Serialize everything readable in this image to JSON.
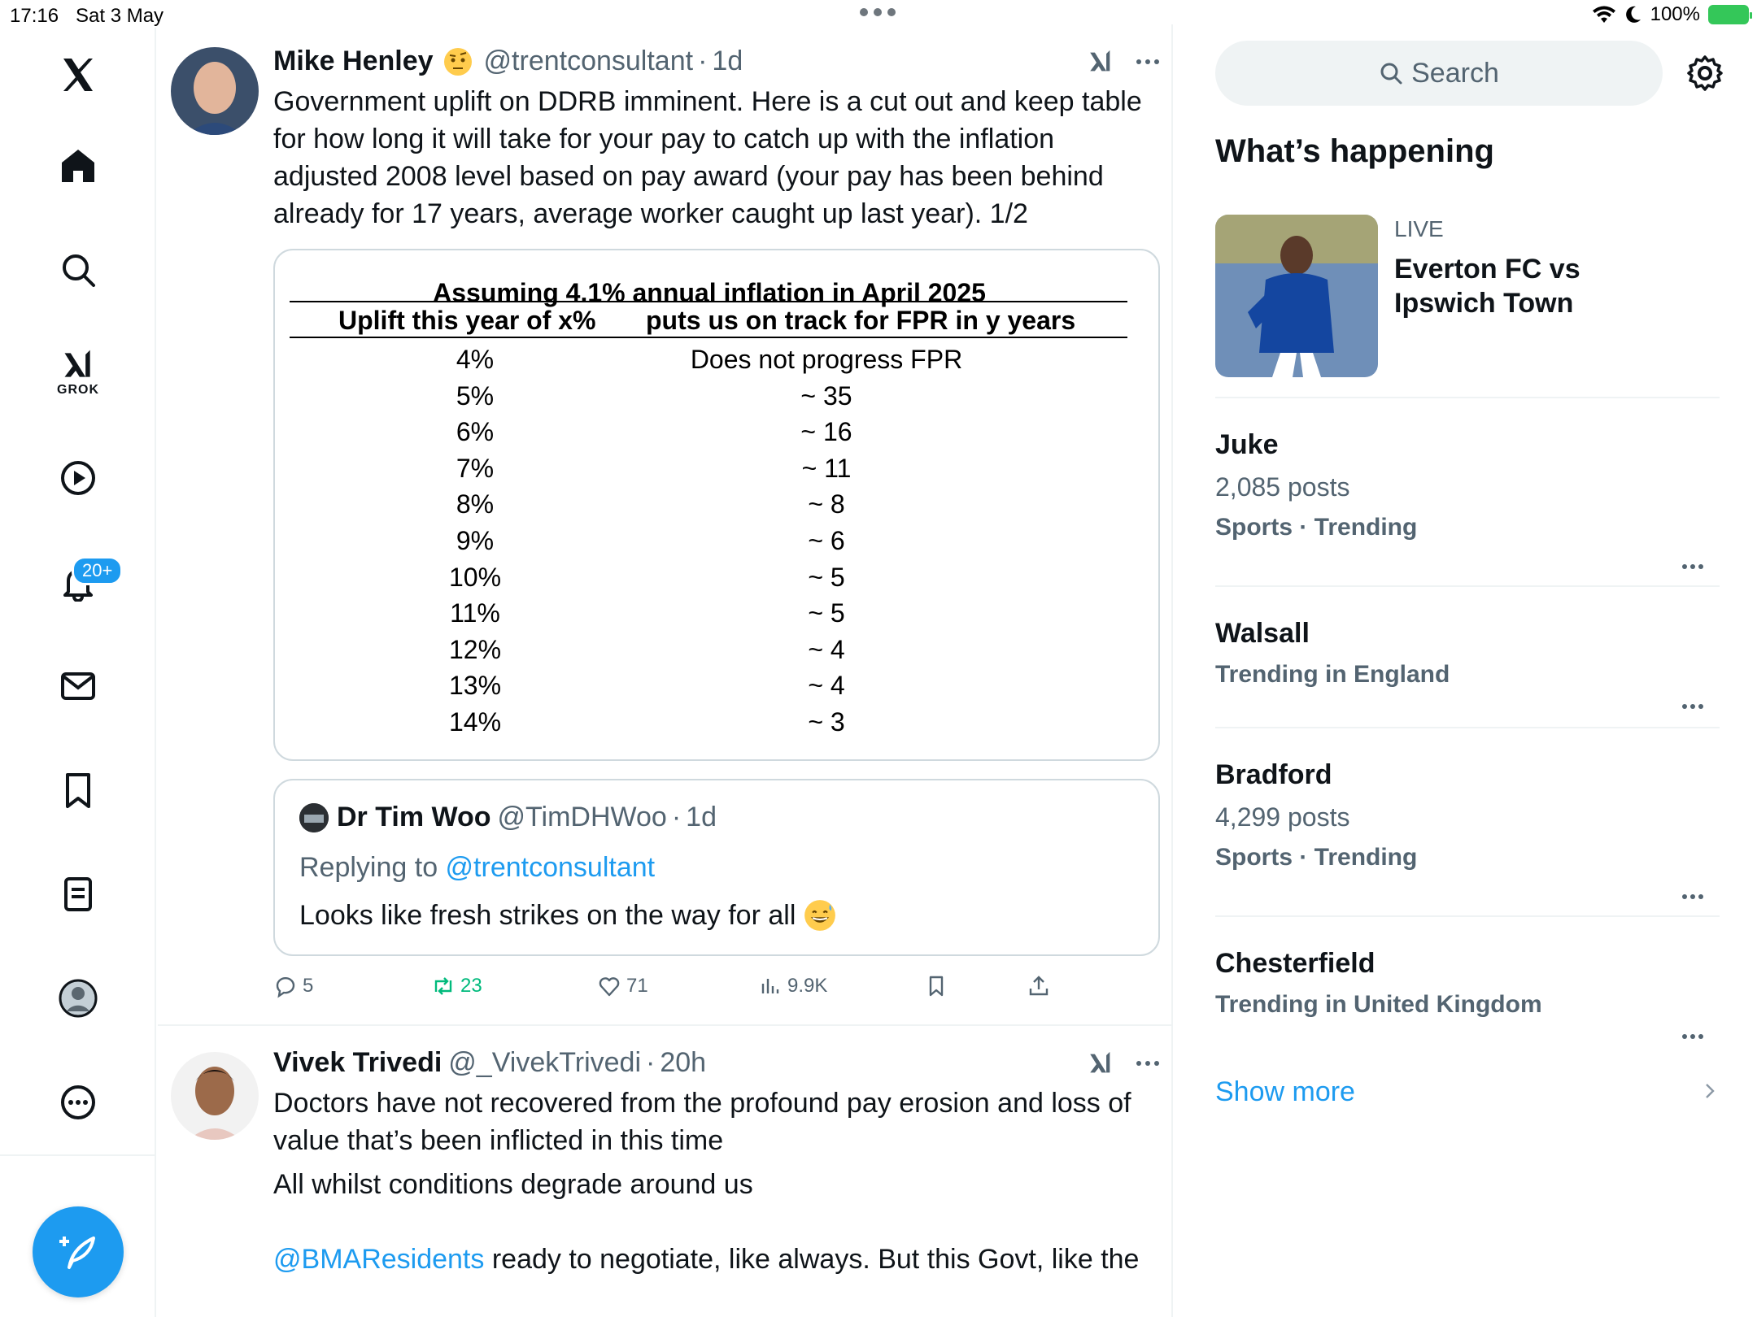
{
  "status_bar": {
    "time": "17:16",
    "date": "Sat 3 May",
    "battery": "100%"
  },
  "nav": {
    "grok_label": "GROK",
    "notifications_badge": "20+"
  },
  "posts": [
    {
      "name": "Mike Henley",
      "handle": "@trentconsultant",
      "sep": "·",
      "time": "1d",
      "text": "Government uplift on DDRB imminent. Here is a cut out and keep table for how long it will take for your pay to catch up with the inflation adjusted 2008 level based on pay award (your pay has been behind already for 17 years, average worker caught up last year). 1/2",
      "table": {
        "title": "Assuming 4.1% annual inflation in April 2025",
        "col1": "Uplift this year of x%",
        "col2": "puts us on track for FPR in y years",
        "rows": [
          [
            "4%",
            "Does not progress FPR"
          ],
          [
            "5%",
            "~ 35"
          ],
          [
            "6%",
            "~ 16"
          ],
          [
            "7%",
            "~ 11"
          ],
          [
            "8%",
            "~ 8"
          ],
          [
            "9%",
            "~ 6"
          ],
          [
            "10%",
            "~ 5"
          ],
          [
            "11%",
            "~ 5"
          ],
          [
            "12%",
            "~ 4"
          ],
          [
            "13%",
            "~ 4"
          ],
          [
            "14%",
            "~ 3"
          ]
        ]
      },
      "quote": {
        "name": "Dr Tim Woo",
        "handle": "@TimDHWoo",
        "sep": "·",
        "time": "1d",
        "replying_prefix": "Replying to ",
        "replying_to": "@trentconsultant",
        "text": "Looks like fresh strikes on the way for all"
      },
      "actions": {
        "replies": "5",
        "reposts": "23",
        "likes": "71",
        "views": "9.9K"
      }
    },
    {
      "name": "Vivek Trivedi",
      "handle": "@_VivekTrivedi",
      "sep": "·",
      "time": "20h",
      "line1": "Doctors have not recovered from the profound pay erosion and loss of value that’s been inflicted in this time",
      "line2": "All whilst conditions degrade around us",
      "mention": "@BMAResidents",
      "line3": " ready to negotiate, like always. But this Govt, like the"
    }
  ],
  "sidebar": {
    "search_placeholder": "Search",
    "title": "What’s happening",
    "live": {
      "label": "LIVE",
      "title": "Everton FC vs Ipswich Town"
    },
    "trends": [
      {
        "name": "Juke",
        "posts": "2,085 posts",
        "category": "Sports · Trending"
      },
      {
        "name": "Walsall",
        "posts": "",
        "category": "Trending in England"
      },
      {
        "name": "Bradford",
        "posts": "4,299 posts",
        "category": "Sports · Trending"
      },
      {
        "name": "Chesterfield",
        "posts": "",
        "category": "Trending in United Kingdom"
      }
    ],
    "show_more": "Show more"
  },
  "colors": {
    "accent": "#1d9bf0",
    "repost": "#00ba7c",
    "muted": "#536471",
    "text": "#0f1419"
  },
  "icons": [
    "x-logo-icon",
    "home-icon",
    "search-icon",
    "grok-icon",
    "video-icon",
    "bell-icon",
    "mail-icon",
    "bookmark-icon",
    "list-icon",
    "profile-icon",
    "more-icon",
    "compose-icon",
    "gear-icon",
    "reply-icon",
    "repost-icon",
    "like-icon",
    "views-icon",
    "share-icon"
  ]
}
